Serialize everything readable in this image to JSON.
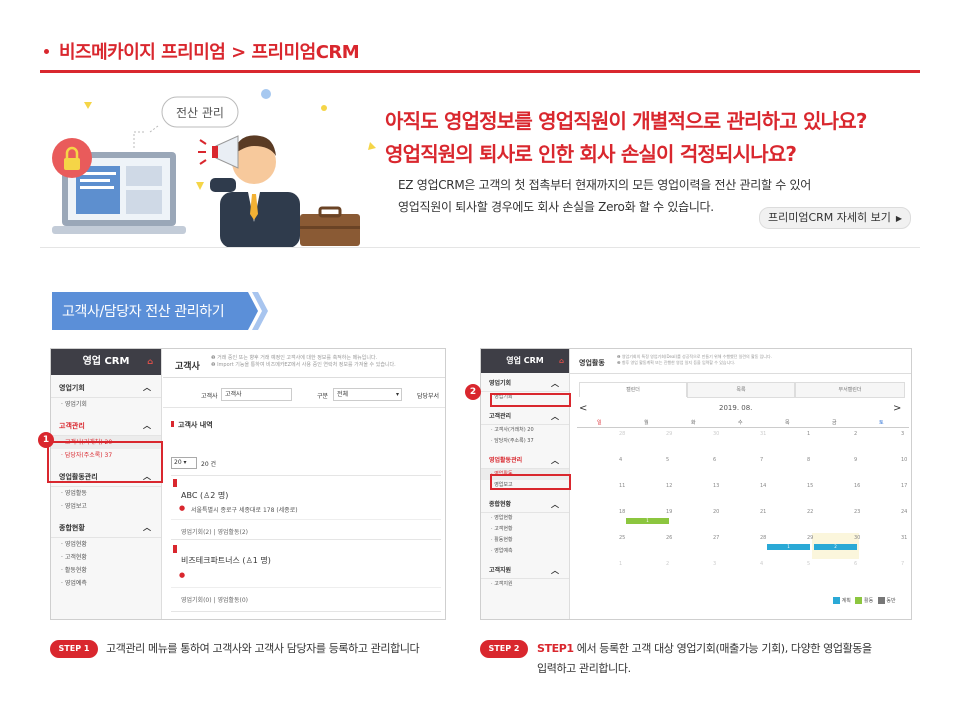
{
  "breadcrumb": {
    "text": "비즈메카이지 프리미엄 > 프리미엄CRM"
  },
  "hero": {
    "bubble": "전산 관리",
    "headline_1": "아직도 영업정보를 영업직원이 개별적으로 관리하고 있나요?",
    "headline_2": "영업직원의 퇴사로 인한 회사 손실이 걱정되시나요?",
    "desc_1": "EZ 영업CRM은 고객의 첫 접촉부터 현재까지의 모든 영업이력을 전산 관리할 수 있어",
    "desc_2": "영업직원이 퇴사할 경우에도 회사 손실을 Zero화 할 수 있습니다.",
    "button": "프리미엄CRM 자세히 보기",
    "button_arrow": "▶"
  },
  "section": {
    "title": "고객사/담당자 전산 관리하기"
  },
  "shot1": {
    "header": "영업 CRM",
    "page_title": "고객사",
    "notice_1": "❶ 거래 중인 또는 향후 거래 예정인 고객사에 대한 정보를 축적하는 메뉴입니다.",
    "notice_2": "❷ Import 기능을 통하여 비즈메카EZ에서 사용 중인 연락처 정보를 가져올 수 있습니다.",
    "search_label": "고객사",
    "search_value": "고객사",
    "type_label": "구분",
    "type_value": "전체",
    "manager_label": "담당부서",
    "list_title": "고객사 내역",
    "page_size": "20",
    "page_size_unit": "20 건",
    "menu": {
      "g1": "영업기회",
      "g1_i1": "영업기회",
      "g2": "고객관리",
      "g2_i1": "고객사(거래처) 20",
      "g2_i2": "담당자(주소록) 37",
      "g3": "영업활동관리",
      "g3_i1": "영업활동",
      "g3_i2": "영업보고",
      "g4": "종합현황",
      "g4_i1": "영업현황",
      "g4_i2": "고객현황",
      "g4_i3": "활동현황",
      "g4_i4": "영업예측"
    },
    "badge": "1",
    "company_1": {
      "name": "ABC",
      "count": "2 명",
      "addr": "서울특별시 종로구 세종대로 178 (세종로)",
      "meta_1": "영업기회(2)",
      "meta_2": "영업활동(2)"
    },
    "company_2": {
      "name": "비즈테크파트너스",
      "count": "1 명",
      "meta_1": "영업기회(0)",
      "meta_2": "영업활동(0)"
    }
  },
  "shot2": {
    "header": "영업 CRM",
    "page_title": "영업활동",
    "notice_1": "❶ 영업기회의 특정 영업기회(Deal)를 성공적으로 만들기 위해 수행했던 일련의 활동 입니다.",
    "notice_2": "❷ 향후 영업 활동계획 또는 진행한 영업 일지 등을 입력할 수 있습니다.",
    "tabs": [
      "캘린더",
      "목록",
      "부서캘린더"
    ],
    "month": "2019. 08.",
    "prev": "<",
    "next": ">",
    "weekdays": [
      "일",
      "월",
      "화",
      "수",
      "목",
      "금",
      "토"
    ],
    "weeks": [
      [
        "28",
        "29",
        "30",
        "31",
        "1",
        "2",
        "3"
      ],
      [
        "4",
        "5",
        "6",
        "7",
        "8",
        "9",
        "10"
      ],
      [
        "11",
        "12",
        "13",
        "14",
        "15",
        "16",
        "17"
      ],
      [
        "18",
        "19",
        "20",
        "21",
        "22",
        "23",
        "24"
      ],
      [
        "25",
        "26",
        "27",
        "28",
        "29",
        "30",
        "31"
      ],
      [
        "1",
        "2",
        "3",
        "4",
        "5",
        "6",
        "7"
      ]
    ],
    "menu": {
      "g1": "영업기회",
      "g1_i1": "영업기회",
      "g2": "고객관리",
      "g2_i1": "고객사(거래처) 20",
      "g2_i2": "담당자(주소록) 37",
      "g3": "영업활동관리",
      "g3_i1": "영업활동",
      "g3_i2": "영업보고",
      "g4": "종합현황",
      "g4_i1": "영업현황",
      "g4_i2": "고객현황",
      "g4_i3": "활동현황",
      "g4_i4": "영업예측",
      "g5": "고객지원",
      "g5_i1": "고객지원"
    },
    "badge": "2",
    "event_1": "1",
    "event_2": "1",
    "event_3": "2",
    "legend": [
      "계획",
      "활동",
      "동반"
    ],
    "colors": {
      "plan": "#2aa9d6",
      "activity": "#8cc63f",
      "with": "#777777"
    }
  },
  "steps": {
    "s1_label": "STEP 1",
    "s1_text": "고객관리 메뉴를 통하여 고객사와 고객사 담당자를 등록하고 관리합니다",
    "s2_label": "STEP 2",
    "s2_text_a": "STEP1",
    "s2_text_b": " 에서 등록한 고객 대상 영업기회(매출가능 기회), 다양한 영업활동을",
    "s2_text_c": "입력하고 관리합니다."
  }
}
